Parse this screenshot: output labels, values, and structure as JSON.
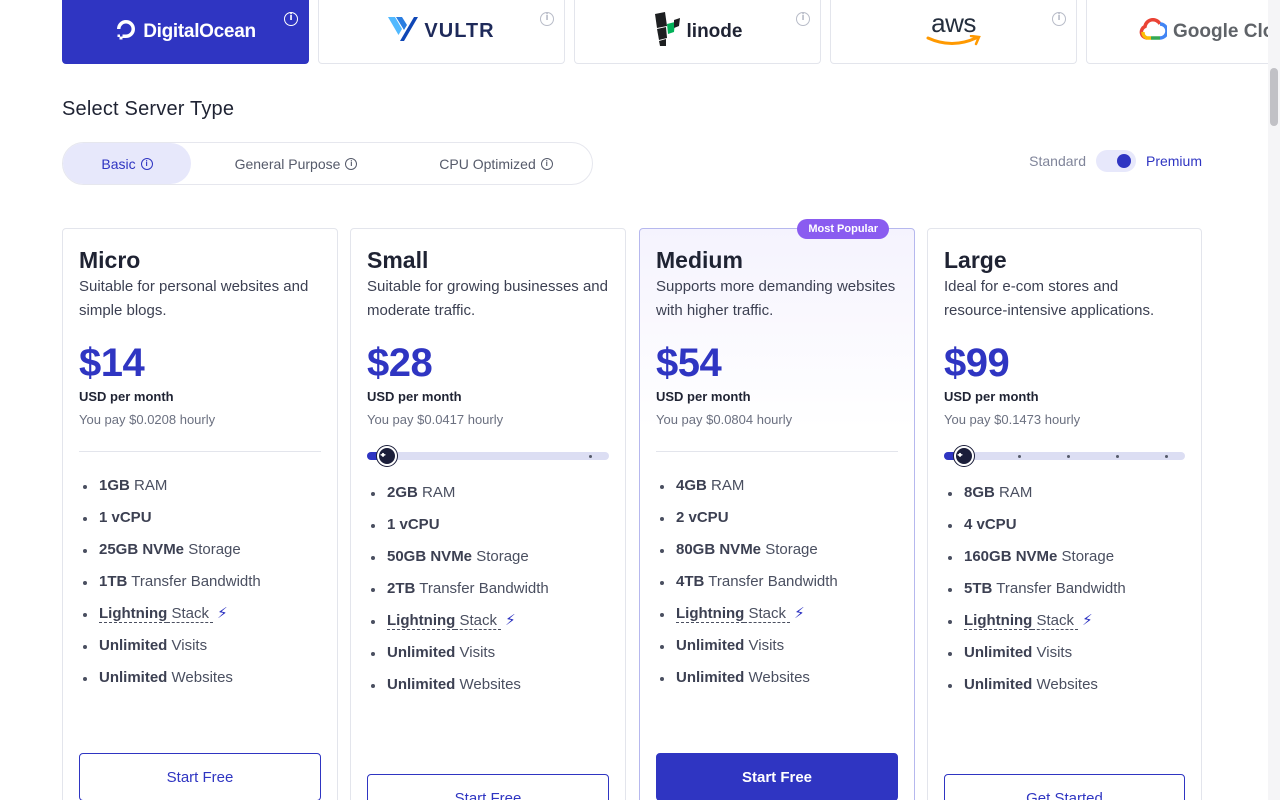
{
  "providers": [
    {
      "name": "DigitalOcean",
      "active": true
    },
    {
      "name": "VULTR",
      "active": false
    },
    {
      "name": "linode",
      "active": false
    },
    {
      "name": "aws",
      "active": false
    },
    {
      "name": "Google Cloud",
      "active": false
    }
  ],
  "section_title": "Select Server Type",
  "server_types": {
    "basic": "Basic",
    "general_purpose": "General Purpose",
    "cpu_optimized": "CPU Optimized"
  },
  "toggle": {
    "off_label": "Standard",
    "on_label": "Premium",
    "state": "Premium"
  },
  "plans": [
    {
      "name": "Micro",
      "description": "Suitable for personal websites and simple blogs.",
      "price": "$14",
      "per": "USD per month",
      "hourly": "You pay $0.0208 hourly",
      "ram_value": "1GB",
      "ram_label": "RAM",
      "cpu": "1 vCPU",
      "storage_value": "25GB NVMe",
      "storage_label": "Storage",
      "bw_value": "1TB",
      "bw_label": "Transfer Bandwidth",
      "ls_a": "Lightning",
      "ls_b": "Stack",
      "visits_value": "Unlimited",
      "visits_label": "Visits",
      "sites_value": "Unlimited",
      "sites_label": "Websites",
      "cta": "Start Free"
    },
    {
      "name": "Small",
      "description": "Suitable for growing businesses and moderate traffic.",
      "price": "$28",
      "per": "USD per month",
      "hourly": "You pay $0.0417 hourly",
      "ram_value": "2GB",
      "ram_label": "RAM",
      "cpu": "1 vCPU",
      "storage_value": "50GB NVMe",
      "storage_label": "Storage",
      "bw_value": "2TB",
      "bw_label": "Transfer Bandwidth",
      "ls_a": "Lightning",
      "ls_b": "Stack",
      "visits_value": "Unlimited",
      "visits_label": "Visits",
      "sites_value": "Unlimited",
      "sites_label": "Websites",
      "cta": "Start Free"
    },
    {
      "name": "Medium",
      "badge": "Most Popular",
      "description": "Supports more demanding websites with higher traffic.",
      "price": "$54",
      "per": "USD per month",
      "hourly": "You pay $0.0804 hourly",
      "ram_value": "4GB",
      "ram_label": "RAM",
      "cpu": "2 vCPU",
      "storage_value": "80GB NVMe",
      "storage_label": "Storage",
      "bw_value": "4TB",
      "bw_label": "Transfer Bandwidth",
      "ls_a": "Lightning",
      "ls_b": "Stack",
      "visits_value": "Unlimited",
      "visits_label": "Visits",
      "sites_value": "Unlimited",
      "sites_label": "Websites",
      "cta": "Start Free"
    },
    {
      "name": "Large",
      "description": "Ideal for e-com stores and resource-intensive applications.",
      "price": "$99",
      "per": "USD per month",
      "hourly": "You pay $0.1473 hourly",
      "ram_value": "8GB",
      "ram_label": "RAM",
      "cpu": "4 vCPU",
      "storage_value": "160GB NVMe",
      "storage_label": "Storage",
      "bw_value": "5TB",
      "bw_label": "Transfer Bandwidth",
      "ls_a": "Lightning",
      "ls_b": "Stack",
      "visits_value": "Unlimited",
      "visits_label": "Visits",
      "sites_value": "Unlimited",
      "sites_label": "Websites",
      "cta": "Get Started"
    }
  ],
  "colors": {
    "accent": "#2f35c2",
    "badge": "#8a5cf0",
    "border": "#e3e5ec"
  }
}
